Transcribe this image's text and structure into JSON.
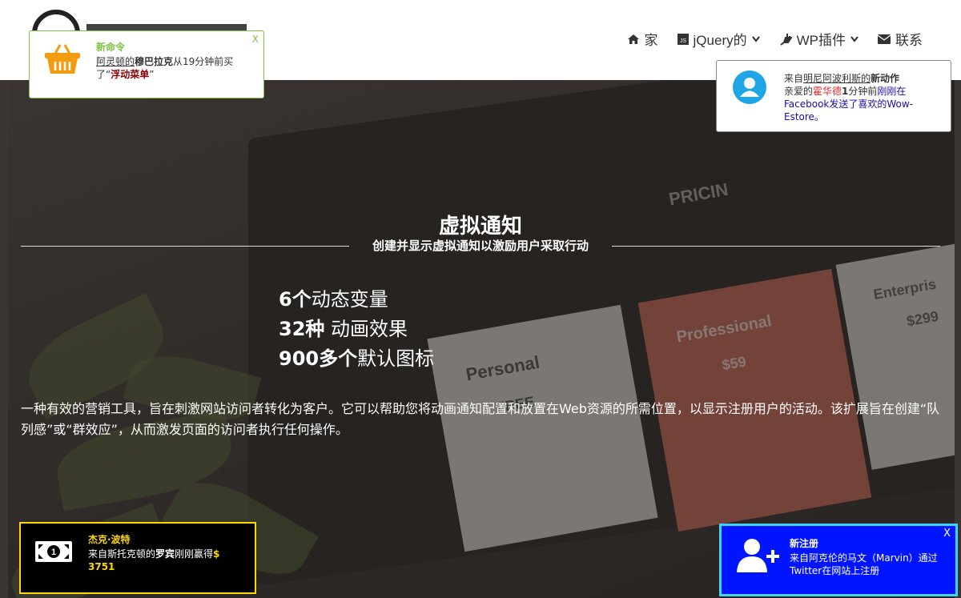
{
  "nav": {
    "home": "家",
    "jquery": "jQuery的",
    "wp": "WP插件",
    "contact": "联系"
  },
  "hero": {
    "title": "虚拟通知",
    "subtitle": "创建并显示虚拟通知以激励用户采取行动",
    "features": [
      {
        "strong": "6个",
        "rest": "动态变量"
      },
      {
        "strong": "32种",
        "rest": " 动画效果"
      },
      {
        "strong": "900多个",
        "rest": "默认图标"
      }
    ],
    "description": "一种有效的营销工具，旨在刺激网站访问者转化为客户。它可以帮助您将动画通知配置和放置在Web资源的所需位置，以显示注册用户的活动。该扩展旨在创建“队列感”或“群效应”，从而激发页面的访问者执行任何操作。"
  },
  "background_mockup": {
    "pricing": "PRICIN",
    "plan1_name": "Personal",
    "plan1_price": "FREE",
    "plan2_name": "Professional",
    "plan2_price": "$59",
    "plan3_name": "Enterpris",
    "plan3_price": "$299"
  },
  "notifications": {
    "n1": {
      "header": "新命令",
      "p1": "阿灵顿的",
      "p2": "穆巴拉克",
      "p3": "从19分钟前买了“",
      "p4": "浮动菜单",
      "p5": "”",
      "close": "X"
    },
    "n2": {
      "h1": "来自",
      "h2": "明尼阿波利斯的",
      "h3": "新动作",
      "b1": "亲爱的",
      "b2": "霍华德",
      "b3": "1",
      "b4": "分钟前",
      "b5": "刚刚在Facebook发送了喜欢的Wow-Estore。"
    },
    "n3": {
      "header": "杰克·波特",
      "b1": "来自斯托克顿的",
      "b2": "罗宾",
      "b3": "刚刚赢得",
      "b4": "$ 3751"
    },
    "n4": {
      "header": "新注册",
      "body": "来自阿克伦的马文（Marvin）通过Twitter在网站上注册",
      "close": "X"
    }
  },
  "colors": {
    "green": "#7dc242",
    "blue_bg": "#0015ff",
    "cyan_border": "#3fd4ff",
    "yellow": "#ffd800",
    "avatar": "#1ea6e6"
  }
}
